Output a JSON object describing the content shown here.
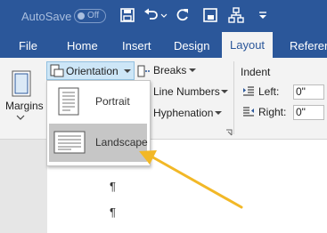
{
  "titlebar": {
    "autosave_label": "AutoSave",
    "autosave_state": "Off"
  },
  "quick_access": [
    "save-icon",
    "undo-icon",
    "redo-icon",
    "touch-mode-icon",
    "diagram-icon",
    "customize-icon"
  ],
  "tabs": [
    {
      "label": "File"
    },
    {
      "label": "Home"
    },
    {
      "label": "Insert"
    },
    {
      "label": "Design"
    },
    {
      "label": "Layout"
    },
    {
      "label": "Reference"
    }
  ],
  "ribbon": {
    "margins_label": "Margins",
    "orientation_label": "Orientation",
    "breaks_label": "Breaks",
    "line_numbers_label": "Line Numbers",
    "hyphenation_label": "Hyphenation",
    "indent_label": "Indent",
    "left_label": "Left:",
    "left_value": "0\"",
    "right_label": "Right:",
    "right_value": "0\""
  },
  "orientation_menu": {
    "items": [
      {
        "label": "Portrait",
        "selected": false
      },
      {
        "label": "Landscape",
        "selected": true
      }
    ]
  },
  "document": {
    "pilcrow": "¶"
  },
  "colors": {
    "brand": "#2b579a",
    "arrow": "#f2b827",
    "selected": "#c6c6c6",
    "button_highlight": "#cde6f7"
  }
}
